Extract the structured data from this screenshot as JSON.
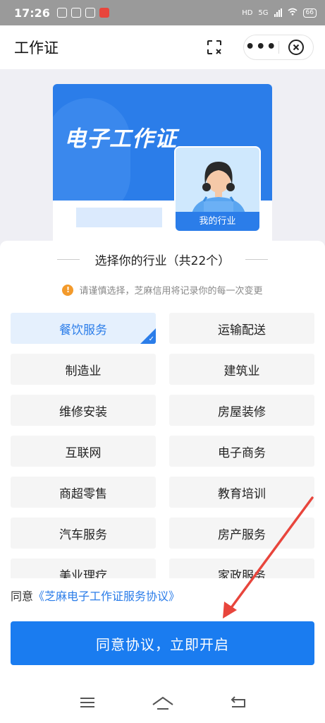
{
  "status_bar": {
    "time": "17:26",
    "network_labels": [
      "HD",
      "5G"
    ],
    "battery": "66"
  },
  "header": {
    "title": "工作证",
    "more_label": "•••",
    "icons": [
      "scan-icon",
      "more-icon",
      "close-icon"
    ]
  },
  "card": {
    "title": "电子工作证",
    "avatar_label": "我的行业"
  },
  "sheet": {
    "title": "选择你的行业（共22个）",
    "notice": "请谨慎选择，芝麻信用将记录你的每一次变更",
    "industries": [
      {
        "label": "餐饮服务",
        "selected": true
      },
      {
        "label": "运输配送",
        "selected": false
      },
      {
        "label": "制造业",
        "selected": false
      },
      {
        "label": "建筑业",
        "selected": false
      },
      {
        "label": "维修安装",
        "selected": false
      },
      {
        "label": "房屋装修",
        "selected": false
      },
      {
        "label": "互联网",
        "selected": false
      },
      {
        "label": "电子商务",
        "selected": false
      },
      {
        "label": "商超零售",
        "selected": false
      },
      {
        "label": "教育培训",
        "selected": false
      },
      {
        "label": "汽车服务",
        "selected": false
      },
      {
        "label": "房产服务",
        "selected": false
      },
      {
        "label": "美业理疗",
        "selected": false
      },
      {
        "label": "家政服务",
        "selected": false
      }
    ],
    "agreement_prefix": "同意",
    "agreement_link": "《芝麻电子工作证服务协议》",
    "cta_label": "同意协议，立即开启"
  },
  "colors": {
    "accent": "#1a7cf0",
    "annotation_arrow": "#e8453c"
  }
}
